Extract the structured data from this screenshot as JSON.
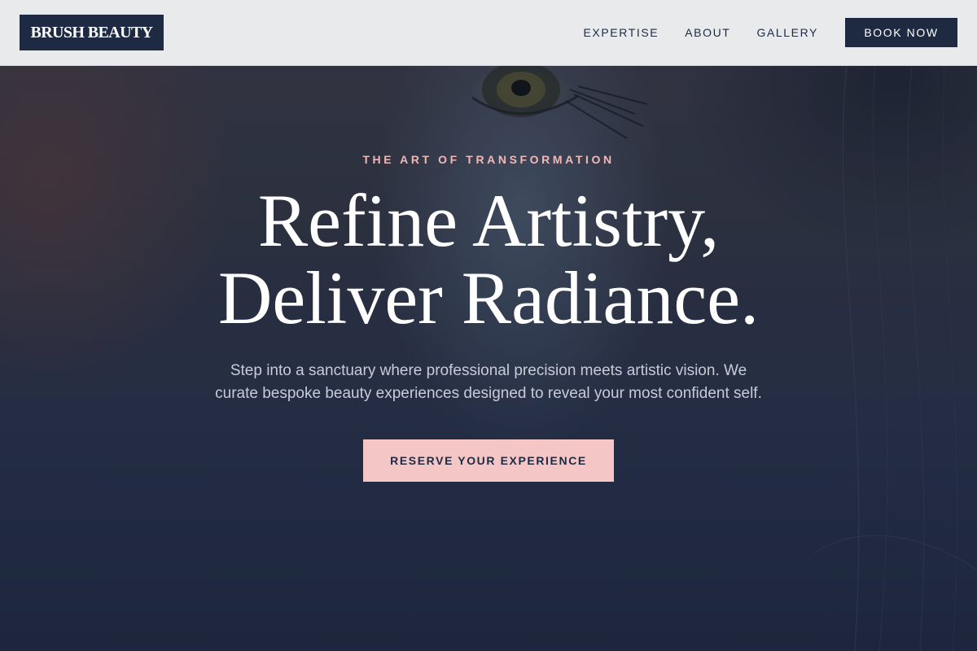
{
  "brand": {
    "logo_text": "BRUSH BEAUTY"
  },
  "nav": {
    "links": [
      "EXPERTISE",
      "ABOUT",
      "GALLERY"
    ],
    "book_label": "BOOK NOW"
  },
  "hero": {
    "eyebrow": "THE ART OF TRANSFORMATION",
    "headline_line1": "Refine Artistry,",
    "headline_line2": "Deliver Radiance.",
    "subtext": "Step into a sanctuary where professional precision meets artistic vision. We curate bespoke beauty experiences designed to reveal your most confident self.",
    "cta_label": "RESERVE YOUR EXPERIENCE"
  },
  "colors": {
    "navy": "#1e2a42",
    "blush": "#f5c6c6",
    "eyebrow_pink": "#f0b8b8",
    "nav_bg": "#e9eaec"
  }
}
